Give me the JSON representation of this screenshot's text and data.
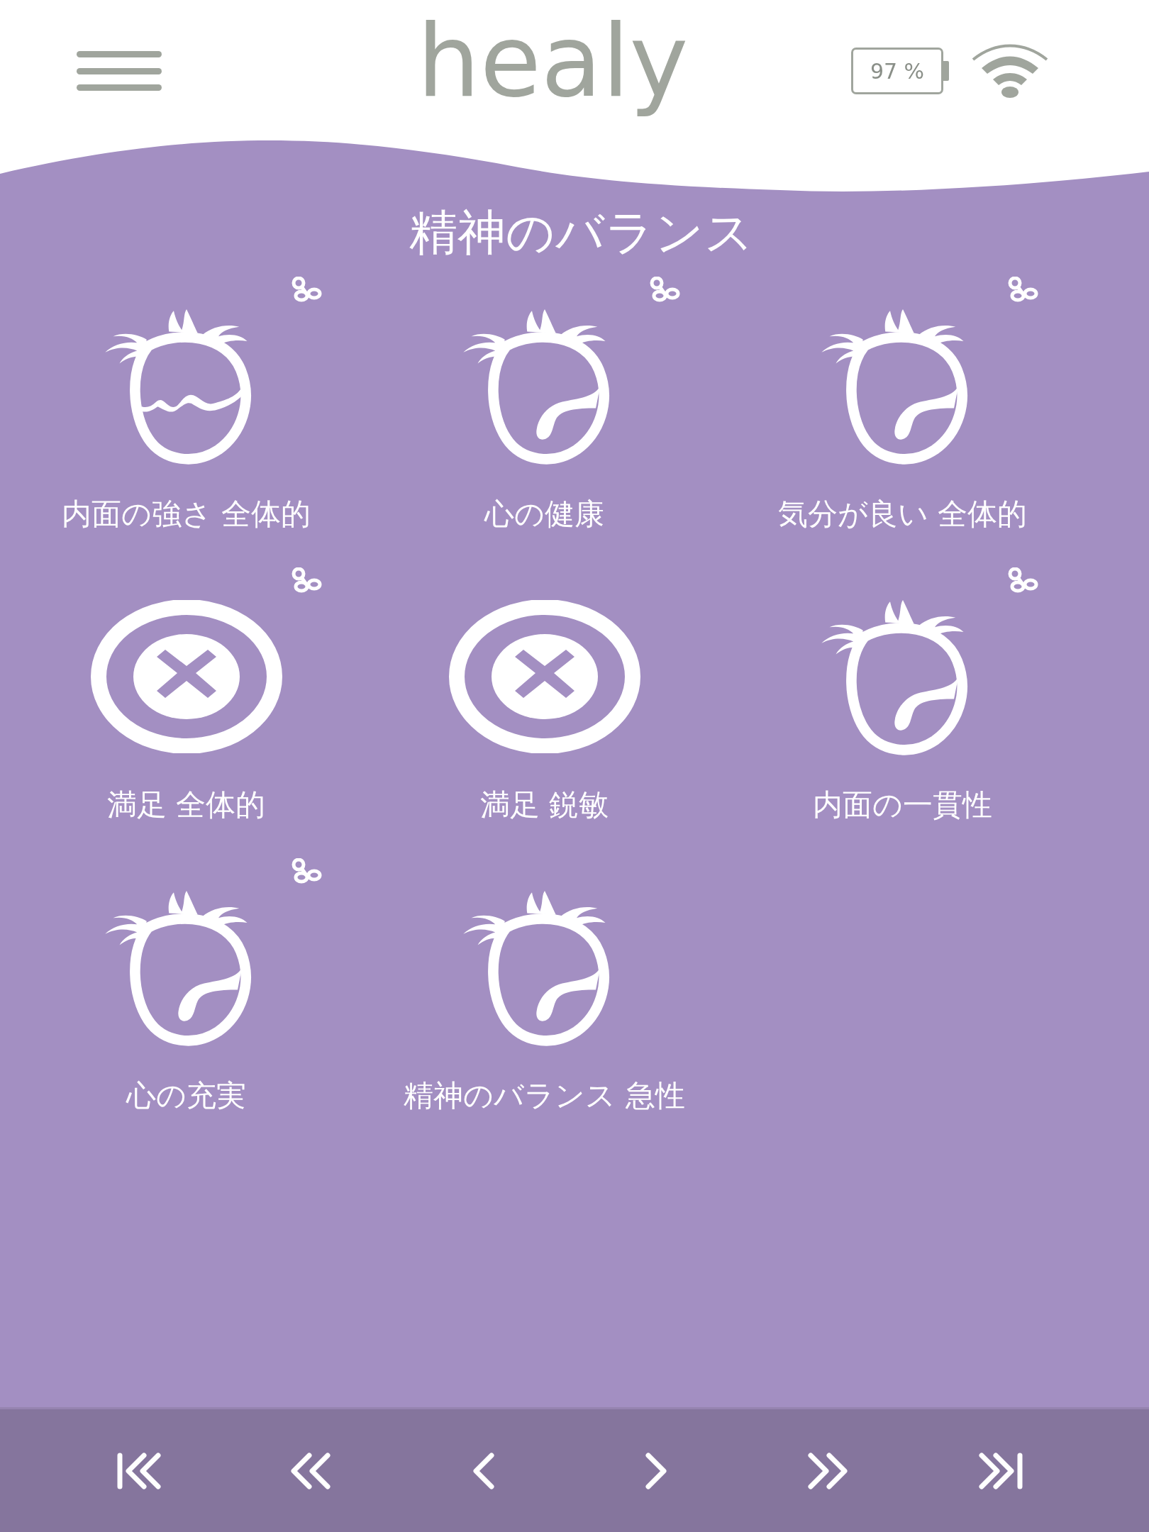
{
  "header": {
    "logo": "healy",
    "battery": "97 %"
  },
  "title": "精神のバランス",
  "items": [
    {
      "label": "内面の強さ 全体的",
      "kind": "wave",
      "linked": true
    },
    {
      "label": "心の健康",
      "kind": "fruit",
      "linked": true
    },
    {
      "label": "気分が良い 全体的",
      "kind": "fruit",
      "linked": true
    },
    {
      "label": "満足 全体的",
      "kind": "blocked",
      "linked": true
    },
    {
      "label": "満足 鋭敏",
      "kind": "blocked",
      "linked": false
    },
    {
      "label": "内面の一貫性",
      "kind": "fruit",
      "linked": true
    },
    {
      "label": "心の充実",
      "kind": "fruit",
      "linked": true
    },
    {
      "label": "精神のバランス 急性",
      "kind": "fruit",
      "linked": false
    }
  ]
}
